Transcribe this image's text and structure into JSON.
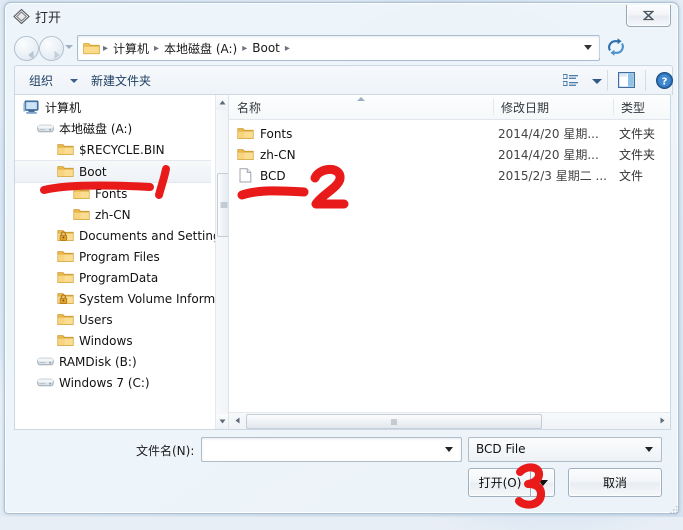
{
  "window": {
    "title": "打开",
    "title_icon": "open-file-icon",
    "close_label": "✕"
  },
  "nav": {
    "back_icon": "back-arrow-icon",
    "forward_icon": "forward-arrow-icon",
    "recent_dropdown_icon": "chevron-down-icon",
    "refresh_icon": "refresh-icon",
    "address_dropdown_icon": "chevron-down-icon",
    "folder_icon": "folder-icon",
    "breadcrumbs": [
      "计算机",
      "本地磁盘 (A:)",
      "Boot"
    ],
    "separator": "▸"
  },
  "toolbar": {
    "organize_label": "组织",
    "organize_caret_icon": "caret-down-icon",
    "new_folder_label": "新建文件夹",
    "view_icon": "view-list-icon",
    "view_caret_icon": "caret-down-icon",
    "preview_pane_icon": "preview-pane-icon",
    "help_icon": "help-circle-icon"
  },
  "tree": {
    "items": [
      {
        "label": "计算机",
        "icon": "computer-icon",
        "indent": 8,
        "selected": false
      },
      {
        "label": "本地磁盘 (A:)",
        "icon": "drive-icon",
        "indent": 22,
        "selected": false
      },
      {
        "label": "$RECYCLE.BIN",
        "icon": "folder-icon",
        "indent": 42,
        "selected": false
      },
      {
        "label": "Boot",
        "icon": "folder-icon",
        "indent": 42,
        "selected": true
      },
      {
        "label": "Fonts",
        "icon": "folder-icon",
        "indent": 58,
        "selected": false
      },
      {
        "label": "zh-CN",
        "icon": "folder-icon",
        "indent": 58,
        "selected": false
      },
      {
        "label": "Documents and Settings",
        "icon": "locked-folder-icon",
        "indent": 42,
        "selected": false
      },
      {
        "label": "Program Files",
        "icon": "folder-icon",
        "indent": 42,
        "selected": false
      },
      {
        "label": "ProgramData",
        "icon": "folder-icon",
        "indent": 42,
        "selected": false
      },
      {
        "label": "System Volume Information",
        "icon": "locked-folder-icon",
        "indent": 42,
        "selected": false
      },
      {
        "label": "Users",
        "icon": "folder-icon",
        "indent": 42,
        "selected": false
      },
      {
        "label": "Windows",
        "icon": "folder-icon",
        "indent": 42,
        "selected": false
      },
      {
        "label": "RAMDisk (B:)",
        "icon": "drive-icon",
        "indent": 22,
        "selected": false
      },
      {
        "label": "Windows 7 (C:)",
        "icon": "drive-icon",
        "indent": 22,
        "selected": false
      }
    ],
    "scrollbar": {
      "up_icon": "scroll-up-icon",
      "down_icon": "scroll-down-icon"
    }
  },
  "filelist": {
    "columns": [
      "名称",
      "修改日期",
      "类型"
    ],
    "sort_column": "名称",
    "sort_direction": "asc",
    "rows": [
      {
        "name": "Fonts",
        "date": "2014/4/20 星期...",
        "type": "文件夹",
        "icon": "folder-icon"
      },
      {
        "name": "zh-CN",
        "date": "2014/4/20 星期...",
        "type": "文件夹",
        "icon": "folder-icon"
      },
      {
        "name": "BCD",
        "date": "2015/2/3 星期二 ...",
        "type": "文件",
        "icon": "file-icon"
      }
    ],
    "hscrollbar": {
      "left_icon": "scroll-left-icon",
      "right_icon": "scroll-right-icon"
    }
  },
  "footer": {
    "filename_label": "文件名(N):",
    "filename_value": "",
    "filename_placeholder": "",
    "filename_caret_icon": "caret-down-icon",
    "filetype_value": "BCD File",
    "filetype_caret_icon": "caret-down-icon",
    "open_label": "打开(O)",
    "open_split_caret_icon": "caret-down-icon",
    "cancel_label": "取消",
    "resize_grip_icon": "resize-grip-icon"
  },
  "annotations": {
    "color": "#e81a1a",
    "marks": [
      {
        "label": "1",
        "kind": "numeral-and-underline",
        "target": "tree-item-boot"
      },
      {
        "label": "2",
        "kind": "numeral-and-underline",
        "target": "file-row-bcd"
      },
      {
        "label": "3",
        "kind": "numeral",
        "target": "open-button"
      }
    ]
  }
}
